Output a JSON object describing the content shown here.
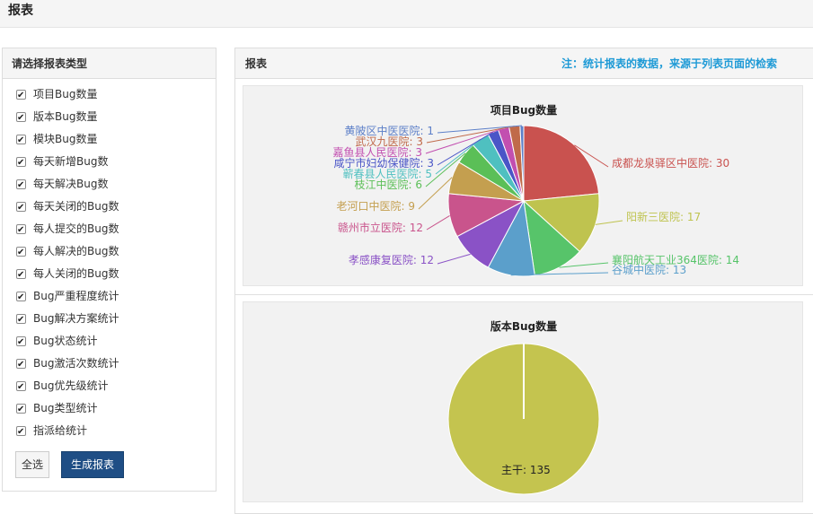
{
  "header": {
    "title": "报表"
  },
  "left": {
    "title": "请选择报表类型",
    "options": [
      "项目Bug数量",
      "版本Bug数量",
      "模块Bug数量",
      "每天新增Bug数",
      "每天解决Bug数",
      "每天关闭的Bug数",
      "每人提交的Bug数",
      "每人解决的Bug数",
      "每人关闭的Bug数",
      "Bug严重程度统计",
      "Bug解决方案统计",
      "Bug状态统计",
      "Bug激活次数统计",
      "Bug优先级统计",
      "Bug类型统计",
      "指派给统计"
    ],
    "select_all": "全选",
    "generate": "生成报表"
  },
  "right": {
    "title": "报表",
    "note": "注：统计报表的数据，来源于列表页面的检索"
  },
  "chart_data": [
    {
      "type": "pie",
      "title": "项目Bug数量",
      "labels": [
        "成都龙泉驿区中医院",
        "阳新三医院",
        "襄阳航天工业364医院",
        "谷城中医院",
        "孝感康复医院",
        "赣州市立医院",
        "老河口中医院",
        "枝江中医院",
        "蕲春县人民医院",
        "咸宁市妇幼保健院",
        "嘉鱼县人民医院",
        "武汉九医院",
        "黄陂区中医医院"
      ],
      "values": [
        30,
        17,
        14,
        13,
        12,
        12,
        9,
        6,
        5,
        3,
        3,
        3,
        1
      ],
      "colors": [
        "#c9524f",
        "#bfc34f",
        "#57c46a",
        "#5b9fcb",
        "#8a52c6",
        "#c9548c",
        "#c49f4f",
        "#5bbf57",
        "#4fc0c0",
        "#4a55c7",
        "#c24fb0",
        "#c06a4a",
        "#5c7fc8"
      ]
    },
    {
      "type": "pie",
      "title": "版本Bug数量",
      "labels": [
        "主干"
      ],
      "values": [
        135
      ],
      "colors": [
        "#c4c44f"
      ]
    }
  ]
}
